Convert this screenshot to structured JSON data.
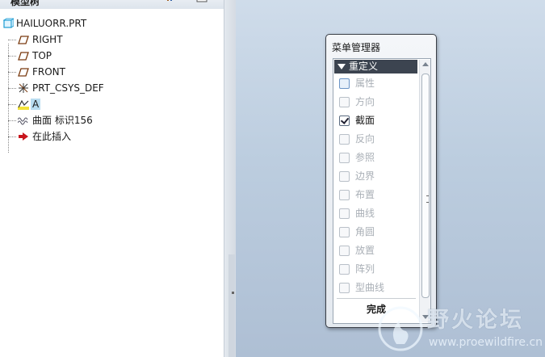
{
  "model_tree": {
    "title": "模型树",
    "items": [
      {
        "label": "HAILUORR.PRT",
        "icon": "part-icon"
      },
      {
        "label": "RIGHT",
        "icon": "datum-plane-icon"
      },
      {
        "label": "TOP",
        "icon": "datum-plane-icon"
      },
      {
        "label": "FRONT",
        "icon": "datum-plane-icon"
      },
      {
        "label": "PRT_CSYS_DEF",
        "icon": "csys-icon"
      },
      {
        "label": "A",
        "icon": "sketch-icon"
      },
      {
        "label": "曲面 标识156",
        "icon": "surface-icon"
      },
      {
        "label": "在此插入",
        "icon": "insert-here-arrow-icon"
      }
    ]
  },
  "menu_manager": {
    "title": "菜单管理器",
    "section": "重定义",
    "items": [
      {
        "label": "属性",
        "checked": false,
        "enabled": false
      },
      {
        "label": "方向",
        "checked": false,
        "enabled": false
      },
      {
        "label": "截面",
        "checked": true,
        "enabled": true
      },
      {
        "label": "反向",
        "checked": false,
        "enabled": false
      },
      {
        "label": "参照",
        "checked": false,
        "enabled": false
      },
      {
        "label": "边界",
        "checked": false,
        "enabled": false
      },
      {
        "label": "布置",
        "checked": false,
        "enabled": false
      },
      {
        "label": "曲线",
        "checked": false,
        "enabled": false
      },
      {
        "label": "角圆",
        "checked": false,
        "enabled": false
      },
      {
        "label": "放置",
        "checked": false,
        "enabled": false
      },
      {
        "label": "阵列",
        "checked": false,
        "enabled": false
      },
      {
        "label": "型曲线",
        "checked": false,
        "enabled": false
      }
    ],
    "done_label": "完成"
  },
  "watermark": {
    "text": "野火论坛",
    "url": "www.proewildfire.cn"
  },
  "colors": {
    "graphics_top": "#cfdcea",
    "graphics_bottom": "#aebfd4",
    "selection": "#b8dcf0",
    "menu_header": "#3c4450"
  }
}
